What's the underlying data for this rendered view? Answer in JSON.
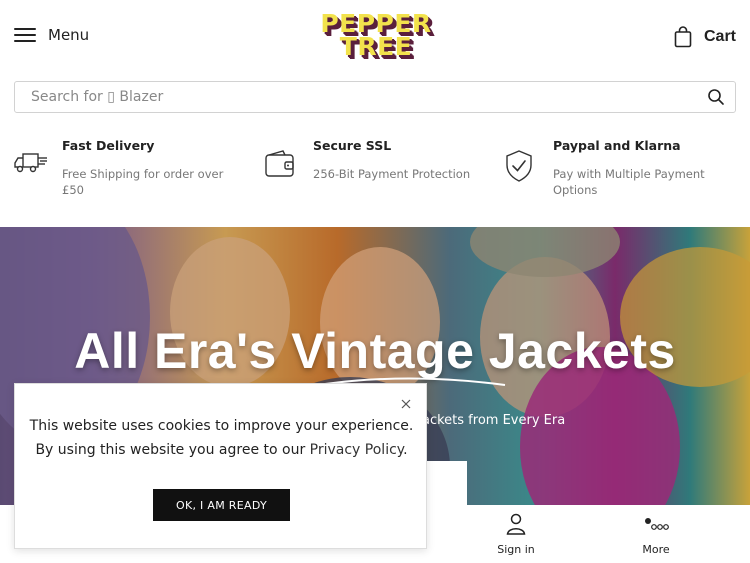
{
  "header": {
    "menu_label": "Menu",
    "logo_line1": "PEPPER",
    "logo_line2": "TREE",
    "cart_label": "Cart"
  },
  "search": {
    "placeholder": "Search for ▯ Blazer"
  },
  "features": [
    {
      "icon": "truck-icon",
      "title": "Fast Delivery",
      "desc": "Free Shipping for order over £50"
    },
    {
      "icon": "wallet-icon",
      "title": "Secure SSL",
      "desc": "256-Bit Payment Protection"
    },
    {
      "icon": "shield-check-icon",
      "title": "Paypal and Klarna",
      "desc": "Pay with Multiple Payment Options"
    }
  ],
  "hero": {
    "title": "All Era's Vintage Jackets",
    "subtitle": "ackets from Every Era"
  },
  "cookie": {
    "line1": "This website uses cookies to improve your experience.",
    "line2_prefix": "By using this website you agree to our ",
    "privacy_link": "Privacy Policy",
    "line2_suffix": ".",
    "button_label": "OK, I AM READY"
  },
  "bottom_nav": {
    "signin_label": "Sign in",
    "more_label": "More"
  },
  "colors": {
    "logo_yellow": "#f2e24c",
    "logo_shadow": "#5a1f3c",
    "cookie_button": "#111111"
  }
}
